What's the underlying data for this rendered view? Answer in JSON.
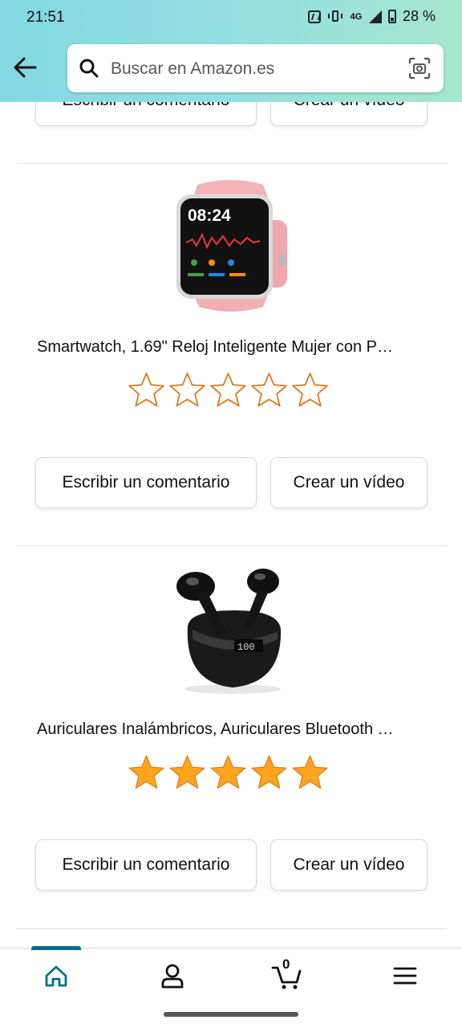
{
  "status_bar": {
    "time": "21:51",
    "network": "4G",
    "battery": "28 %"
  },
  "search": {
    "placeholder": "Buscar en Amazon.es"
  },
  "products": [
    {
      "title": "Smartwatch, 1.69\" Reloj Inteligente Mujer con P…",
      "watch_time": "08:24",
      "rating_filled": 0,
      "rating_max": 5,
      "comment_label": "Escribir un comentario",
      "video_label": "Crear un vídeo"
    },
    {
      "title": "Auriculares Inalámbricos, Auriculares Bluetooth …",
      "case_display": "100",
      "rating_filled": 5,
      "rating_max": 5,
      "comment_label": "Escribir un comentario",
      "video_label": "Crear un vídeo"
    }
  ],
  "top_partial": {
    "comment_label": "Escribir un comentario",
    "video_label": "Crear un vídeo"
  },
  "bottom_nav": {
    "items": [
      "home-icon",
      "account-icon",
      "cart-icon",
      "menu-icon"
    ],
    "cart_count": "0",
    "active_index": 0
  },
  "colors": {
    "accent": "#007185",
    "star_filled": "#ffa41c",
    "star_outline": "#de7921"
  }
}
